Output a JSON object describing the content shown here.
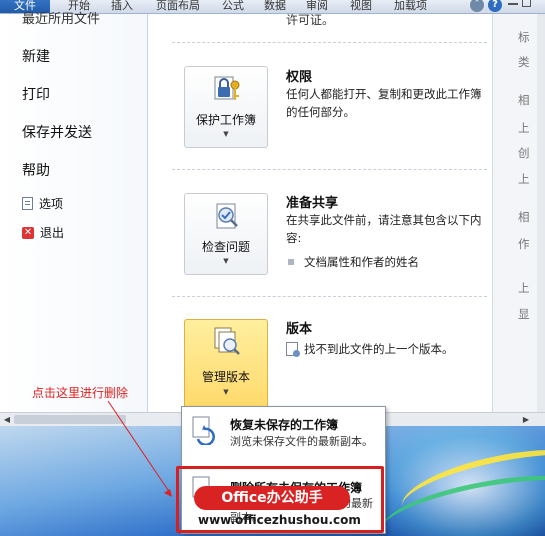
{
  "ribbon": {
    "tabs": [
      "文件",
      "开始",
      "插入",
      "页面布局",
      "公式",
      "数据",
      "审阅",
      "视图",
      "加载项"
    ]
  },
  "nav": {
    "cut_item": "最近所用文件",
    "items": [
      "新建",
      "打印",
      "保存并发送",
      "帮助"
    ],
    "options": "选项",
    "exit": "退出"
  },
  "main": {
    "cut_text": "许可证。",
    "sections": [
      {
        "button": "保护工作簿",
        "title": "权限",
        "desc": "任何人都能打开、复制和更改此工作簿的任何部分。",
        "icon": "lock-key-icon"
      },
      {
        "button": "检查问题",
        "title": "准备共享",
        "desc": "在共享此文件前，请注意其包含以下内容:",
        "bullet": "文档属性和作者的姓名",
        "icon": "inspect-document-icon"
      },
      {
        "button": "管理版本",
        "title": "版本",
        "desc": "找不到此文件的上一个版本。",
        "icon": "manage-versions-icon"
      }
    ]
  },
  "preview": {
    "labels": [
      "标",
      "类",
      "相",
      "上",
      "创",
      "上",
      "相",
      "作",
      "上",
      "显"
    ]
  },
  "menu": {
    "items": [
      {
        "title": "恢复未保存的工作簿",
        "desc": "浏览未保存文件的最新副本。"
      },
      {
        "title": "删除所有未保存的工作簿",
        "desc": "删除所有未保存的文件的最新副本。"
      }
    ]
  },
  "annotation": {
    "text": "点击这里进行删除"
  },
  "watermark": {
    "brand": "Office办公助手",
    "url": "www.officezhushou.com"
  },
  "colors": {
    "file_tab": "#1f5aa8",
    "highlight": "#ffd96a",
    "annotation": "#e02020"
  }
}
